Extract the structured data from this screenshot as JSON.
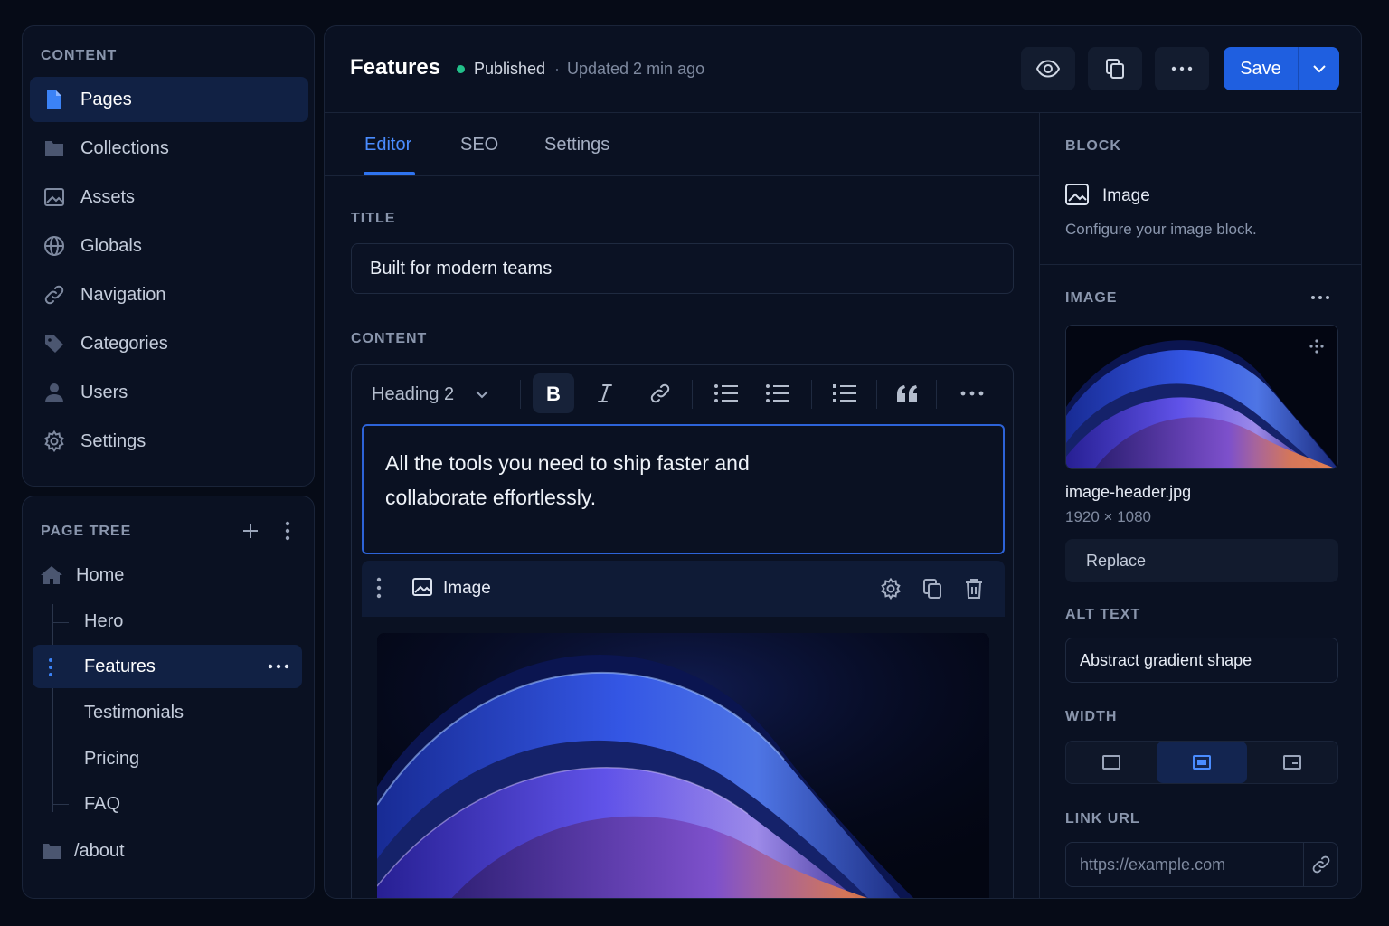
{
  "sidebar": {
    "section_title": "CONTENT",
    "items": [
      {
        "label": "Pages",
        "icon": "file-icon",
        "active": true
      },
      {
        "label": "Collections",
        "icon": "folder-icon"
      },
      {
        "label": "Assets",
        "icon": "image-icon"
      },
      {
        "label": "Globals",
        "icon": "globe-icon"
      },
      {
        "label": "Navigation",
        "icon": "link-icon"
      },
      {
        "label": "Categories",
        "icon": "tag-icon"
      },
      {
        "label": "Users",
        "icon": "user-icon"
      },
      {
        "label": "Settings",
        "icon": "gear-icon"
      }
    ]
  },
  "page_tree": {
    "section_title": "PAGE TREE",
    "items": [
      {
        "label": "Home",
        "icon": "home-icon"
      },
      {
        "label": "Hero"
      },
      {
        "label": "Features",
        "active": true
      },
      {
        "label": "Testimonials"
      },
      {
        "label": "Pricing"
      },
      {
        "label": "FAQ"
      },
      {
        "label": "/about",
        "icon": "folder-icon"
      }
    ]
  },
  "header": {
    "title": "Features",
    "status": "Published",
    "separator": "·",
    "updated": "Updated 2 min ago",
    "save_label": "Save"
  },
  "tabs": [
    "Editor",
    "SEO",
    "Settings"
  ],
  "editor": {
    "title_label": "TITLE",
    "title_value": "Built for modern teams",
    "content_label": "CONTENT",
    "heading_select": "Heading 2",
    "text_line1": "All the tools you need to ship faster and",
    "text_line2": "collaborate effortlessly.",
    "image_block_label": "Image"
  },
  "inspector": {
    "block_title": "BLOCK",
    "block_name": "Image",
    "block_desc": "Configure your image block.",
    "image_title": "IMAGE",
    "file_name": "image-header.jpg",
    "file_dims": "1920 × 1080",
    "replace_label": "Replace",
    "alt_title": "ALT TEXT",
    "alt_value": "Abstract gradient shape",
    "width_title": "WIDTH",
    "width_selected": "medium",
    "link_title": "LINK URL",
    "link_placeholder": "https://example.com"
  },
  "colors": {
    "accent": "#2f74f0",
    "save_button": "#1f5fe0",
    "status_published": "#22c08a",
    "background": "#060b17",
    "panel": "#0a1122"
  }
}
